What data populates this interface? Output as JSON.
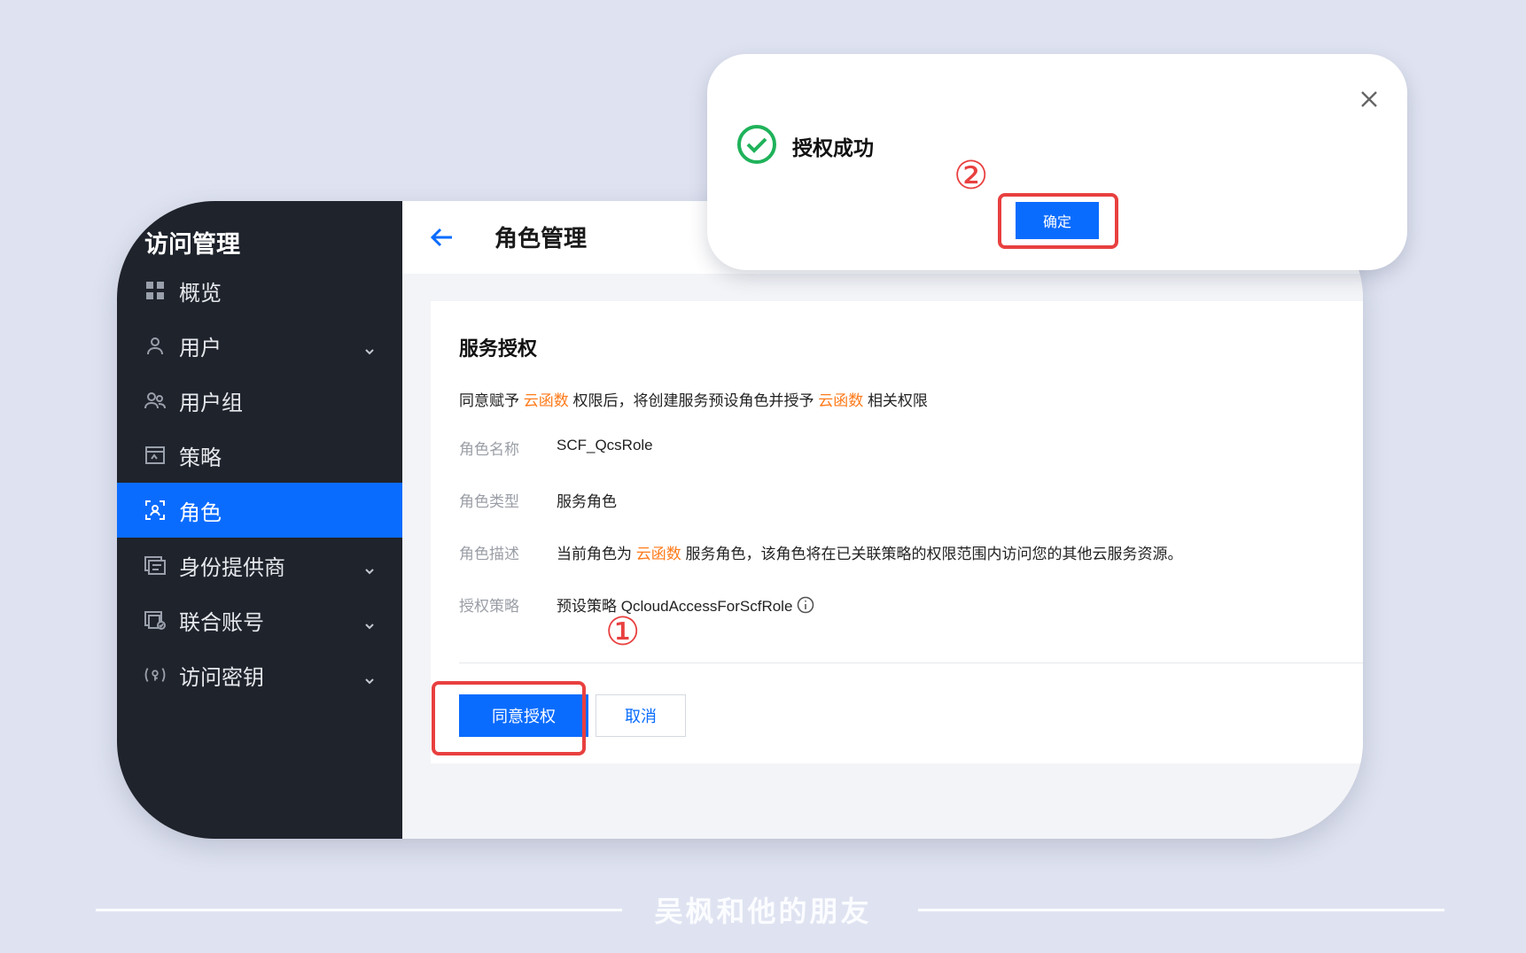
{
  "sidebar": {
    "title": "访问管理",
    "items": [
      {
        "label": "概览",
        "icon": "grid-icon"
      },
      {
        "label": "用户",
        "icon": "user-icon",
        "has_children": true
      },
      {
        "label": "用户组",
        "icon": "user-group-icon"
      },
      {
        "label": "策略",
        "icon": "policy-icon"
      },
      {
        "label": "角色",
        "icon": "role-icon",
        "active": true
      },
      {
        "label": "身份提供商",
        "icon": "identity-provider-icon",
        "has_children": true
      },
      {
        "label": "联合账号",
        "icon": "federated-account-icon",
        "has_children": true
      },
      {
        "label": "访问密钥",
        "icon": "access-key-icon",
        "has_children": true
      }
    ]
  },
  "header": {
    "title": "角色管理"
  },
  "card": {
    "title": "服务授权",
    "desc": {
      "p1": "同意赋予",
      "hl1": "云函数",
      "p2": "权限后，将创建服务预设角色并授予",
      "hl2": "云函数",
      "p3": "相关权限"
    },
    "fields": [
      {
        "key": "角色名称",
        "value": "SCF_QcsRole"
      },
      {
        "key": "角色类型",
        "value": "服务角色"
      },
      {
        "key": "角色描述",
        "value_pre": "当前角色为",
        "value_hl": "云函数",
        "value_post": "服务角色，该角色将在已关联策略的权限范围内访问您的其他云服务资源。"
      },
      {
        "key": "授权策略",
        "value": "预设策略 QcloudAccessForScfRole"
      }
    ],
    "confirm_label": "同意授权",
    "cancel_label": "取消"
  },
  "dialog": {
    "title": "授权成功",
    "ok_label": "确定"
  },
  "annotations": {
    "step1": "①",
    "step2": "②"
  },
  "footer": {
    "text": "吴枫和他的朋友"
  },
  "colors": {
    "accent": "#0a6cff",
    "highlight": "#ff7a1a",
    "sidebar_bg": "#1f232c",
    "success": "#1fb25a",
    "annotation": "#e8403f"
  }
}
